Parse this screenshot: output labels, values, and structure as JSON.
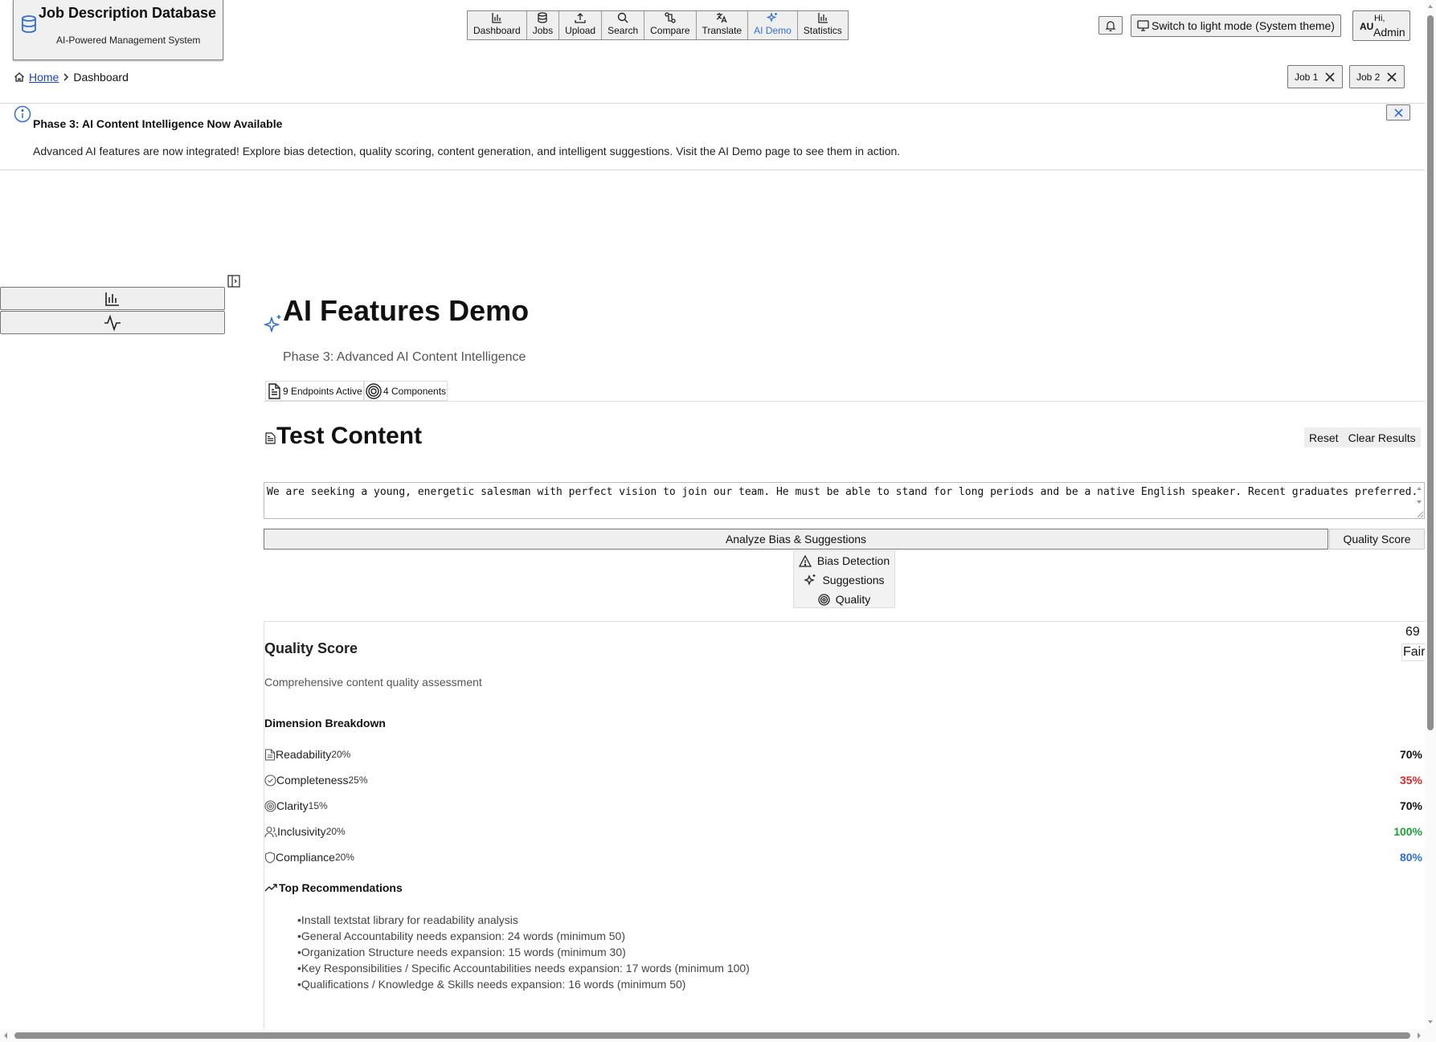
{
  "header": {
    "app_title": "Job Description Database",
    "app_subtitle": "AI-Powered Management System",
    "nav": [
      {
        "label": "Dashboard",
        "icon": "bar-chart-icon",
        "active": false
      },
      {
        "label": "Jobs",
        "icon": "database-icon",
        "active": false
      },
      {
        "label": "Upload",
        "icon": "upload-icon",
        "active": false
      },
      {
        "label": "Search",
        "icon": "search-icon",
        "active": false
      },
      {
        "label": "Compare",
        "icon": "compare-icon",
        "active": false
      },
      {
        "label": "Translate",
        "icon": "translate-icon",
        "active": false
      },
      {
        "label": "AI Demo",
        "icon": "sparkles-icon",
        "active": true
      },
      {
        "label": "Statistics",
        "icon": "bar-chart-icon",
        "active": false
      }
    ],
    "theme_button": "Switch to light mode (System theme)",
    "user": {
      "initials": "AU",
      "greeting": "Hi,",
      "name": "Admin"
    }
  },
  "breadcrumb": {
    "home": "Home",
    "current": "Dashboard"
  },
  "compare_chips": [
    "Job 1",
    "Job 2"
  ],
  "banner": {
    "title": "Phase 3: AI Content Intelligence Now Available",
    "text": "Advanced AI features are now integrated! Explore bias detection, quality scoring, content generation, and intelligent suggestions. Visit the AI Demo page to see them in action."
  },
  "page": {
    "title": "AI Features Demo",
    "subtitle": "Phase 3: Advanced AI Content Intelligence",
    "badges": [
      "9 Endpoints Active",
      "4 Components"
    ]
  },
  "test_content": {
    "heading": "Test Content",
    "reset_label": "Reset",
    "clear_label": "Clear Results",
    "text": "We are seeking a young, energetic salesman with perfect vision to join our team. He must be able to stand for long periods and be a native English speaker. Recent graduates preferred.",
    "analyze_label": "Analyze Bias & Suggestions",
    "quality_label": "Quality Score"
  },
  "result_tabs": [
    "Bias Detection",
    "Suggestions",
    "Quality"
  ],
  "quality": {
    "title": "Quality Score",
    "description": "Comprehensive content quality assessment",
    "score": "69",
    "rating": "Fair",
    "dimensions_heading": "Dimension Breakdown",
    "dimensions": [
      {
        "name": "Readability",
        "weight": "20%",
        "value": "70%",
        "color": "#111111",
        "icon": "document-icon"
      },
      {
        "name": "Completeness",
        "weight": "25%",
        "value": "35%",
        "color": "#d92b2b",
        "icon": "check-circle-icon"
      },
      {
        "name": "Clarity",
        "weight": "15%",
        "value": "70%",
        "color": "#111111",
        "icon": "target-icon"
      },
      {
        "name": "Inclusivity",
        "weight": "20%",
        "value": "100%",
        "color": "#1f9e3a",
        "icon": "users-icon"
      },
      {
        "name": "Compliance",
        "weight": "20%",
        "value": "80%",
        "color": "#2f6fdc",
        "icon": "shield-icon"
      }
    ],
    "recommendations_heading": "Top Recommendations",
    "recommendations": [
      "Install textstat library for readability analysis",
      "General Accountability needs expansion: 24 words (minimum 50)",
      "Organization Structure needs expansion: 15 words (minimum 30)",
      "Key Responsibilities / Specific Accountabilities needs expansion: 17 words (minimum 100)",
      "Qualifications / Knowledge & Skills needs expansion: 16 words (minimum 50)"
    ]
  }
}
